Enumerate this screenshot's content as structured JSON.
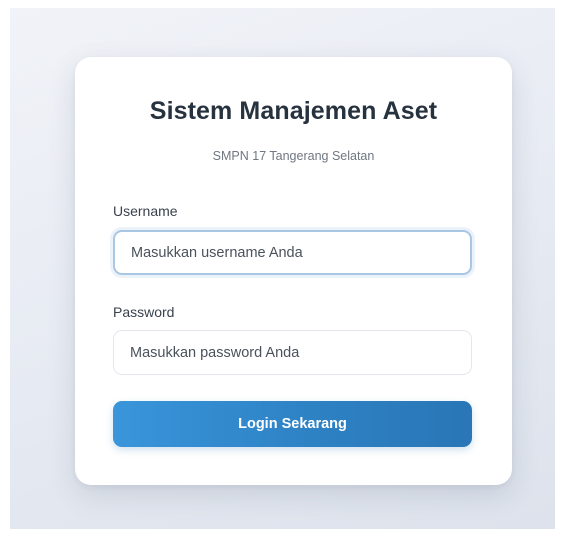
{
  "app": {
    "title": "Sistem Manajemen Aset",
    "subtitle": "SMPN 17 Tangerang Selatan"
  },
  "form": {
    "username": {
      "label": "Username",
      "value": "",
      "placeholder": "Masukkan username Anda"
    },
    "password": {
      "label": "Password",
      "value": "",
      "placeholder": "Masukkan password Anda"
    },
    "submit_label": "Login Sekarang"
  },
  "colors": {
    "primary_button": "#2d82c4",
    "focus_border": "#a9c7e3",
    "title_text": "#27323f",
    "background": "#e6eaf2"
  }
}
